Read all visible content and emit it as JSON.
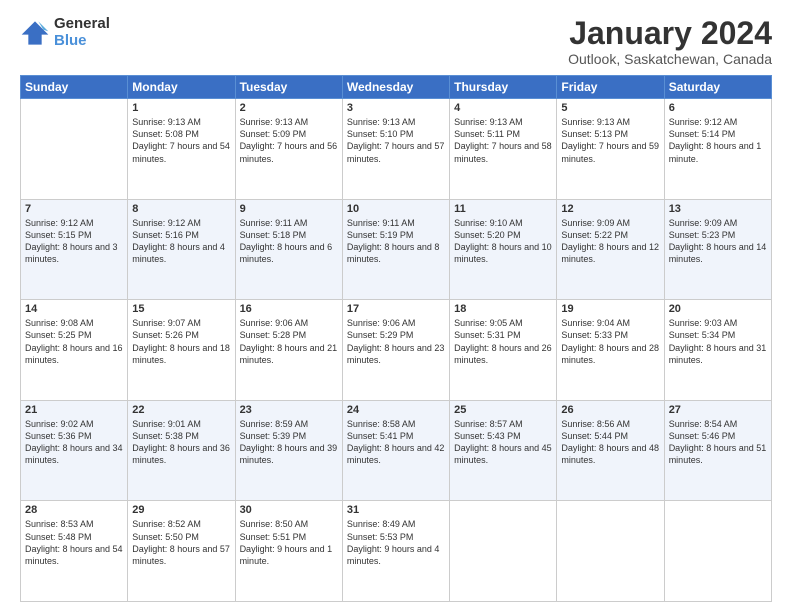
{
  "logo": {
    "general": "General",
    "blue": "Blue"
  },
  "header": {
    "title": "January 2024",
    "subtitle": "Outlook, Saskatchewan, Canada"
  },
  "weekdays": [
    "Sunday",
    "Monday",
    "Tuesday",
    "Wednesday",
    "Thursday",
    "Friday",
    "Saturday"
  ],
  "weeks": [
    [
      {
        "day": "",
        "sunrise": "",
        "sunset": "",
        "daylight": ""
      },
      {
        "day": "1",
        "sunrise": "Sunrise: 9:13 AM",
        "sunset": "Sunset: 5:08 PM",
        "daylight": "Daylight: 7 hours and 54 minutes."
      },
      {
        "day": "2",
        "sunrise": "Sunrise: 9:13 AM",
        "sunset": "Sunset: 5:09 PM",
        "daylight": "Daylight: 7 hours and 56 minutes."
      },
      {
        "day": "3",
        "sunrise": "Sunrise: 9:13 AM",
        "sunset": "Sunset: 5:10 PM",
        "daylight": "Daylight: 7 hours and 57 minutes."
      },
      {
        "day": "4",
        "sunrise": "Sunrise: 9:13 AM",
        "sunset": "Sunset: 5:11 PM",
        "daylight": "Daylight: 7 hours and 58 minutes."
      },
      {
        "day": "5",
        "sunrise": "Sunrise: 9:13 AM",
        "sunset": "Sunset: 5:13 PM",
        "daylight": "Daylight: 7 hours and 59 minutes."
      },
      {
        "day": "6",
        "sunrise": "Sunrise: 9:12 AM",
        "sunset": "Sunset: 5:14 PM",
        "daylight": "Daylight: 8 hours and 1 minute."
      }
    ],
    [
      {
        "day": "7",
        "sunrise": "Sunrise: 9:12 AM",
        "sunset": "Sunset: 5:15 PM",
        "daylight": "Daylight: 8 hours and 3 minutes."
      },
      {
        "day": "8",
        "sunrise": "Sunrise: 9:12 AM",
        "sunset": "Sunset: 5:16 PM",
        "daylight": "Daylight: 8 hours and 4 minutes."
      },
      {
        "day": "9",
        "sunrise": "Sunrise: 9:11 AM",
        "sunset": "Sunset: 5:18 PM",
        "daylight": "Daylight: 8 hours and 6 minutes."
      },
      {
        "day": "10",
        "sunrise": "Sunrise: 9:11 AM",
        "sunset": "Sunset: 5:19 PM",
        "daylight": "Daylight: 8 hours and 8 minutes."
      },
      {
        "day": "11",
        "sunrise": "Sunrise: 9:10 AM",
        "sunset": "Sunset: 5:20 PM",
        "daylight": "Daylight: 8 hours and 10 minutes."
      },
      {
        "day": "12",
        "sunrise": "Sunrise: 9:09 AM",
        "sunset": "Sunset: 5:22 PM",
        "daylight": "Daylight: 8 hours and 12 minutes."
      },
      {
        "day": "13",
        "sunrise": "Sunrise: 9:09 AM",
        "sunset": "Sunset: 5:23 PM",
        "daylight": "Daylight: 8 hours and 14 minutes."
      }
    ],
    [
      {
        "day": "14",
        "sunrise": "Sunrise: 9:08 AM",
        "sunset": "Sunset: 5:25 PM",
        "daylight": "Daylight: 8 hours and 16 minutes."
      },
      {
        "day": "15",
        "sunrise": "Sunrise: 9:07 AM",
        "sunset": "Sunset: 5:26 PM",
        "daylight": "Daylight: 8 hours and 18 minutes."
      },
      {
        "day": "16",
        "sunrise": "Sunrise: 9:06 AM",
        "sunset": "Sunset: 5:28 PM",
        "daylight": "Daylight: 8 hours and 21 minutes."
      },
      {
        "day": "17",
        "sunrise": "Sunrise: 9:06 AM",
        "sunset": "Sunset: 5:29 PM",
        "daylight": "Daylight: 8 hours and 23 minutes."
      },
      {
        "day": "18",
        "sunrise": "Sunrise: 9:05 AM",
        "sunset": "Sunset: 5:31 PM",
        "daylight": "Daylight: 8 hours and 26 minutes."
      },
      {
        "day": "19",
        "sunrise": "Sunrise: 9:04 AM",
        "sunset": "Sunset: 5:33 PM",
        "daylight": "Daylight: 8 hours and 28 minutes."
      },
      {
        "day": "20",
        "sunrise": "Sunrise: 9:03 AM",
        "sunset": "Sunset: 5:34 PM",
        "daylight": "Daylight: 8 hours and 31 minutes."
      }
    ],
    [
      {
        "day": "21",
        "sunrise": "Sunrise: 9:02 AM",
        "sunset": "Sunset: 5:36 PM",
        "daylight": "Daylight: 8 hours and 34 minutes."
      },
      {
        "day": "22",
        "sunrise": "Sunrise: 9:01 AM",
        "sunset": "Sunset: 5:38 PM",
        "daylight": "Daylight: 8 hours and 36 minutes."
      },
      {
        "day": "23",
        "sunrise": "Sunrise: 8:59 AM",
        "sunset": "Sunset: 5:39 PM",
        "daylight": "Daylight: 8 hours and 39 minutes."
      },
      {
        "day": "24",
        "sunrise": "Sunrise: 8:58 AM",
        "sunset": "Sunset: 5:41 PM",
        "daylight": "Daylight: 8 hours and 42 minutes."
      },
      {
        "day": "25",
        "sunrise": "Sunrise: 8:57 AM",
        "sunset": "Sunset: 5:43 PM",
        "daylight": "Daylight: 8 hours and 45 minutes."
      },
      {
        "day": "26",
        "sunrise": "Sunrise: 8:56 AM",
        "sunset": "Sunset: 5:44 PM",
        "daylight": "Daylight: 8 hours and 48 minutes."
      },
      {
        "day": "27",
        "sunrise": "Sunrise: 8:54 AM",
        "sunset": "Sunset: 5:46 PM",
        "daylight": "Daylight: 8 hours and 51 minutes."
      }
    ],
    [
      {
        "day": "28",
        "sunrise": "Sunrise: 8:53 AM",
        "sunset": "Sunset: 5:48 PM",
        "daylight": "Daylight: 8 hours and 54 minutes."
      },
      {
        "day": "29",
        "sunrise": "Sunrise: 8:52 AM",
        "sunset": "Sunset: 5:50 PM",
        "daylight": "Daylight: 8 hours and 57 minutes."
      },
      {
        "day": "30",
        "sunrise": "Sunrise: 8:50 AM",
        "sunset": "Sunset: 5:51 PM",
        "daylight": "Daylight: 9 hours and 1 minute."
      },
      {
        "day": "31",
        "sunrise": "Sunrise: 8:49 AM",
        "sunset": "Sunset: 5:53 PM",
        "daylight": "Daylight: 9 hours and 4 minutes."
      },
      {
        "day": "",
        "sunrise": "",
        "sunset": "",
        "daylight": ""
      },
      {
        "day": "",
        "sunrise": "",
        "sunset": "",
        "daylight": ""
      },
      {
        "day": "",
        "sunrise": "",
        "sunset": "",
        "daylight": ""
      }
    ]
  ]
}
